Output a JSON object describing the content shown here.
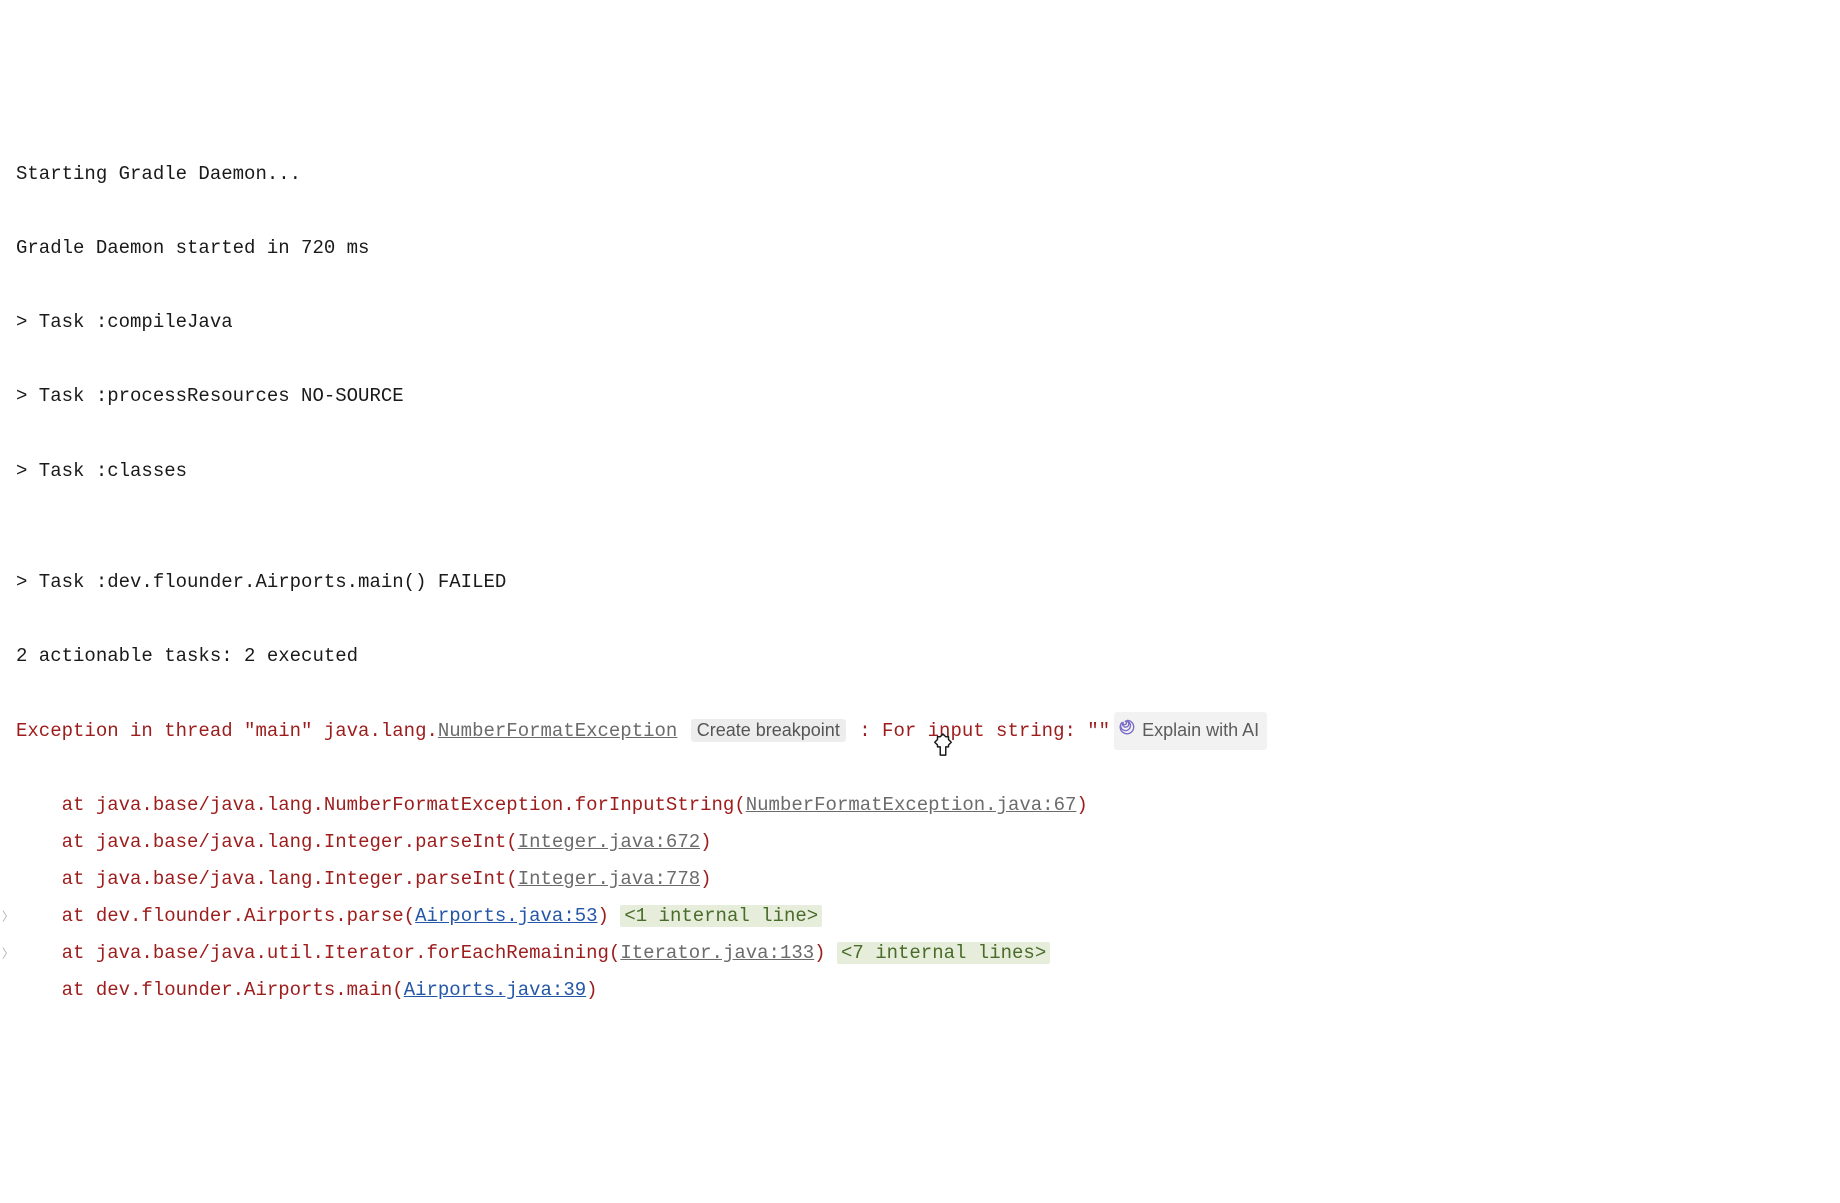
{
  "lines": {
    "l0": "Starting Gradle Daemon...",
    "l1": "Gradle Daemon started in 720 ms",
    "l2": "> Task :compileJava",
    "l3": "> Task :processResources NO-SOURCE",
    "l4": "> Task :classes",
    "l5": "",
    "l6": "> Task :dev.flounder.Airports.main() FAILED",
    "l7": "2 actionable tasks: 2 executed"
  },
  "exception": {
    "prefix": "Exception in thread \"main\" java.lang.",
    "class_link": "NumberFormatException",
    "bp_label": "Create breakpoint",
    "msg_prefix": ": For input string: \"\"",
    "ai_label": "Explain with AI"
  },
  "stack": [
    {
      "indent": "    ",
      "at": "at ",
      "call": "java.base/java.lang.NumberFormatException.forInputString(",
      "link": "NumberFormatException.java:67",
      "link_style": "gray",
      "close": ")",
      "fold": "",
      "toggle": false
    },
    {
      "indent": "    ",
      "at": "at ",
      "call": "java.base/java.lang.Integer.parseInt(",
      "link": "Integer.java:672",
      "link_style": "gray",
      "close": ")",
      "fold": "",
      "toggle": false
    },
    {
      "indent": "    ",
      "at": "at ",
      "call": "java.base/java.lang.Integer.parseInt(",
      "link": "Integer.java:778",
      "link_style": "gray",
      "close": ")",
      "fold": "",
      "toggle": false
    },
    {
      "indent": "    ",
      "at": "at ",
      "call": "dev.flounder.Airports.parse(",
      "link": "Airports.java:53",
      "link_style": "blue",
      "close": ")",
      "fold": "<1 internal line>",
      "toggle": true
    },
    {
      "indent": "    ",
      "at": "at ",
      "call": "java.base/java.util.Iterator.forEachRemaining(",
      "link": "Iterator.java:133",
      "link_style": "gray",
      "close": ")",
      "fold": "<7 internal lines>",
      "toggle": true
    },
    {
      "indent": "    ",
      "at": "at ",
      "call": "dev.flounder.Airports.main(",
      "link": "Airports.java:39",
      "link_style": "blue",
      "close": ")",
      "fold": "",
      "toggle": false
    }
  ]
}
